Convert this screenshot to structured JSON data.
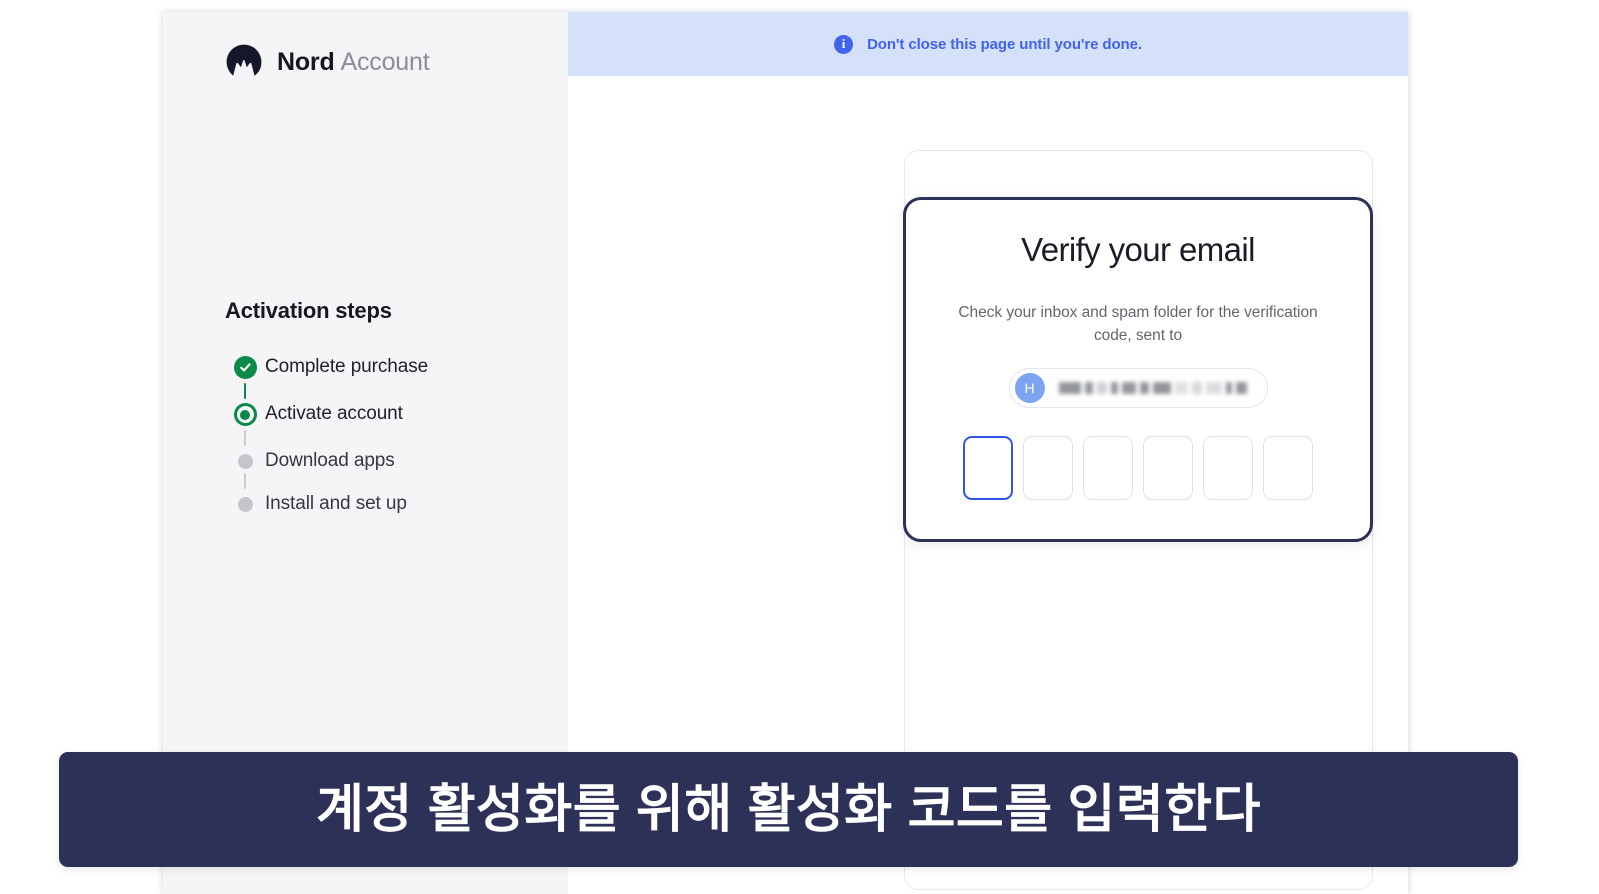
{
  "brand": {
    "name_bold": "Nord",
    "name_light": "Account",
    "logo_icon": "nord-mountain-logo"
  },
  "sidebar": {
    "steps_title": "Activation steps",
    "steps": [
      {
        "label": "Complete purchase",
        "state": "done"
      },
      {
        "label": "Activate account",
        "state": "current"
      },
      {
        "label": "Download apps",
        "state": "todo"
      },
      {
        "label": "Install and set up",
        "state": "todo"
      }
    ]
  },
  "banner": {
    "icon": "info-circle-icon",
    "text": "Don't close this page until you're done.",
    "background_color": "#d4e1f8",
    "text_color": "#4263eb"
  },
  "verify_card": {
    "title": "Verify your email",
    "subtitle": "Check your inbox and spam folder for the verification code, sent to",
    "email": {
      "avatar_initial": "H",
      "avatar_color": "#7ea3f0",
      "address_redacted": true
    },
    "otp": {
      "length": 6,
      "values": [
        "",
        "",
        "",
        "",
        "",
        ""
      ],
      "focused_index": 0,
      "focus_color": "#2f58e8"
    },
    "border_color": "#2e3157"
  },
  "caption": {
    "text": "계정 활성화를 위해 활성화 코드를 입력한다",
    "background_color": "#2e3157",
    "text_color": "#ffffff"
  }
}
